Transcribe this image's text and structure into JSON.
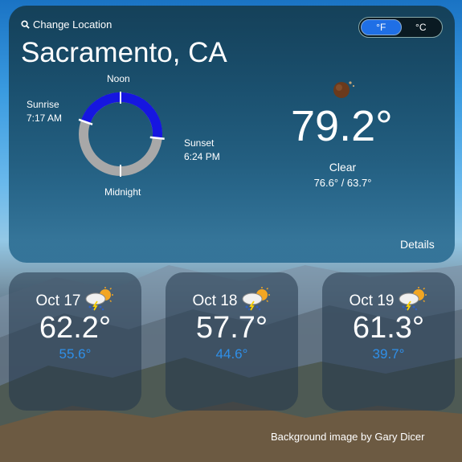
{
  "header": {
    "change_location_label": "Change Location",
    "city": "Sacramento, CA",
    "units": {
      "fahrenheit": "°F",
      "celsius": "°C",
      "selected": "°F"
    }
  },
  "sun": {
    "noon_label": "Noon",
    "midnight_label": "Midnight",
    "sunrise_label": "Sunrise",
    "sunrise_time": "7:17 AM",
    "sunset_label": "Sunset",
    "sunset_time": "6:24 PM",
    "daylight_color": "#1616e0",
    "night_color": "#a8a8a8"
  },
  "current": {
    "icon": "moon-icon",
    "temperature": "79.2°",
    "condition": "Clear",
    "high_low": "76.6° / 63.7°",
    "details_label": "Details"
  },
  "forecast": [
    {
      "date": "Oct 17",
      "icon": "storm-sun-icon",
      "high": "62.2°",
      "low": "55.6°"
    },
    {
      "date": "Oct 18",
      "icon": "storm-sun-icon",
      "high": "57.7°",
      "low": "44.6°"
    },
    {
      "date": "Oct 19",
      "icon": "storm-sun-icon",
      "high": "61.3°",
      "low": "39.7°"
    }
  ],
  "footer": {
    "credit": "Background image by Gary Dicer"
  },
  "colors": {
    "low_temp": "#2f8fe8",
    "toggle_active": "#1f6fe6"
  }
}
